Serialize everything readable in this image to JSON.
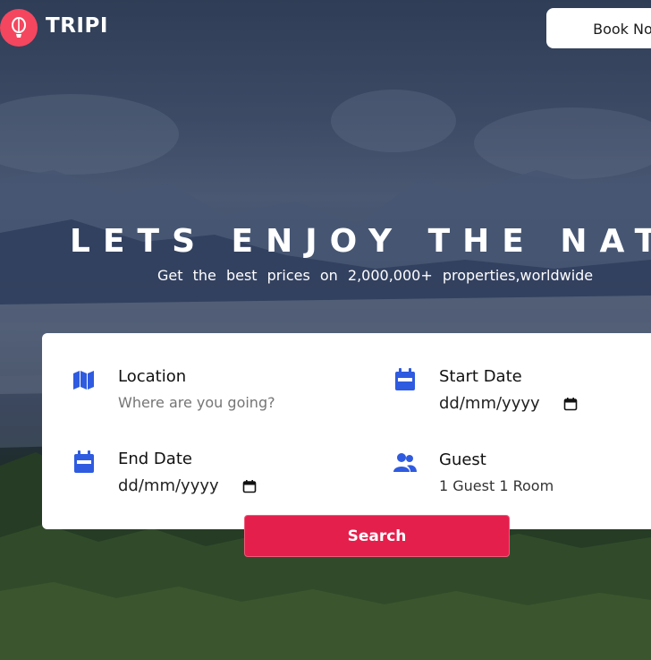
{
  "brand": {
    "name": "TRIPI",
    "accent": "#f4465f"
  },
  "header": {
    "book_button_label": "Book Now"
  },
  "hero": {
    "headline": "LETS ENJOY THE NATURE",
    "subline": "Get the best prices on 2,000,000+ properties,worldwide"
  },
  "search_form": {
    "location": {
      "label": "Location",
      "placeholder": "Where are you going?",
      "icon": "map-icon"
    },
    "start_date": {
      "label": "Start Date",
      "value": "dd/mm/yyyy",
      "icon": "calendar-icon"
    },
    "end_date": {
      "label": "End Date",
      "value": "dd/mm/yyyy",
      "icon": "calendar-icon"
    },
    "guest": {
      "label": "Guest",
      "value": "1 Guest 1 Room",
      "icon": "users-icon"
    },
    "search_button_label": "Search",
    "icon_color": "#2f5be0",
    "button_color": "#e41f4c"
  }
}
